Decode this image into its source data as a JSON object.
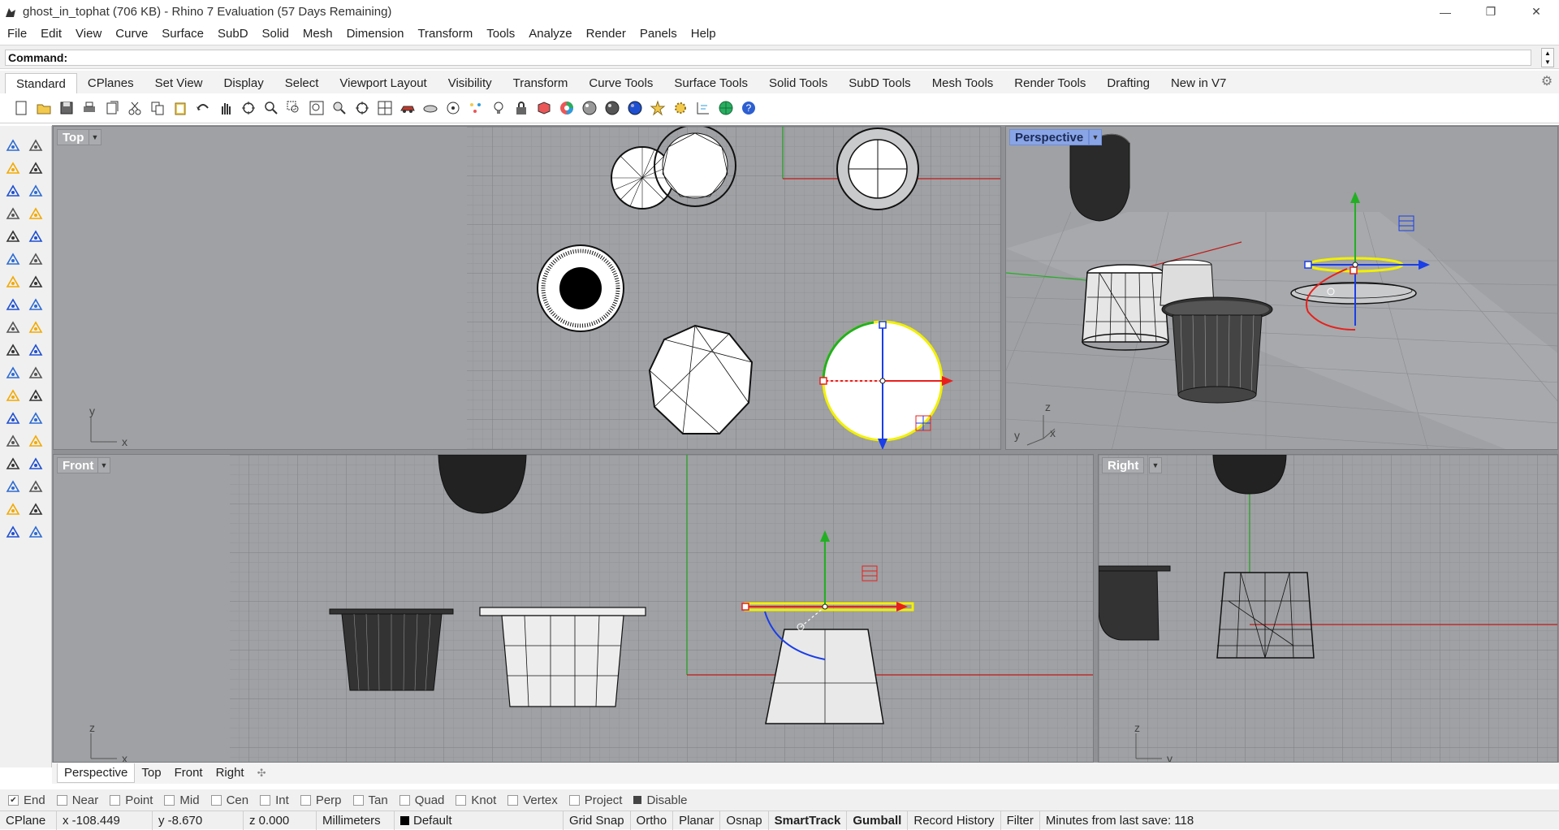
{
  "window": {
    "title": "ghost_in_tophat (706 KB) - Rhino 7 Evaluation (57 Days Remaining)",
    "minimize": "—",
    "restore": "❐",
    "close": "✕"
  },
  "menu": [
    "File",
    "Edit",
    "View",
    "Curve",
    "Surface",
    "SubD",
    "Solid",
    "Mesh",
    "Dimension",
    "Transform",
    "Tools",
    "Analyze",
    "Render",
    "Panels",
    "Help"
  ],
  "command": {
    "label": "Command:",
    "value": ""
  },
  "toolbar_tabs": [
    "Standard",
    "CPlanes",
    "Set View",
    "Display",
    "Select",
    "Viewport Layout",
    "Visibility",
    "Transform",
    "Curve Tools",
    "Surface Tools",
    "Solid Tools",
    "SubD Tools",
    "Mesh Tools",
    "Render Tools",
    "Drafting",
    "New in V7"
  ],
  "toolbar_icons": [
    "new-file-icon",
    "open-file-icon",
    "save-icon",
    "print-icon",
    "import-icon",
    "cut-icon",
    "copy-icon",
    "paste-icon",
    "undo-icon",
    "pan-hand-icon",
    "rotate-view-icon",
    "zoom-icon",
    "zoom-window-icon",
    "zoom-extents-icon",
    "zoom-selected-icon",
    "rotate-view-icon",
    "four-viewports-icon",
    "car-shaded-icon",
    "object-properties-icon",
    "circle-icon",
    "points-icon",
    "light-bulb-icon",
    "lock-icon",
    "cube-render-icon",
    "color-wheel-icon",
    "sphere-material-icon",
    "sphere-render-icon",
    "blue-sphere-icon",
    "stars-icon",
    "gear-group-icon",
    "dimension-icon",
    "globe-icon",
    "help-icon"
  ],
  "viewports": {
    "top": {
      "label": "Top",
      "axis_a": "y",
      "axis_b": "x"
    },
    "perspective": {
      "label": "Perspective",
      "axis_a": "z",
      "axis_b": "y",
      "axis_c": "x"
    },
    "front": {
      "label": "Front",
      "axis_a": "z",
      "axis_b": "x"
    },
    "right": {
      "label": "Right",
      "axis_a": "z",
      "axis_b": "y"
    }
  },
  "viewport_tabs": [
    "Perspective",
    "Top",
    "Front",
    "Right"
  ],
  "add_tab_icon": "✣",
  "osnaps": [
    {
      "label": "End",
      "checked": true
    },
    {
      "label": "Near",
      "checked": false
    },
    {
      "label": "Point",
      "checked": false
    },
    {
      "label": "Mid",
      "checked": false
    },
    {
      "label": "Cen",
      "checked": false
    },
    {
      "label": "Int",
      "checked": false
    },
    {
      "label": "Perp",
      "checked": false
    },
    {
      "label": "Tan",
      "checked": false
    },
    {
      "label": "Quad",
      "checked": false
    },
    {
      "label": "Knot",
      "checked": false
    },
    {
      "label": "Vertex",
      "checked": false
    },
    {
      "label": "Project",
      "checked": false
    }
  ],
  "osnap_disable": "Disable",
  "status": {
    "cplane": "CPlane",
    "x": "x -108.449",
    "y": "y -8.670",
    "z": "z 0.000",
    "units": "Millimeters",
    "layer": "Default",
    "grid_snap": "Grid Snap",
    "ortho": "Ortho",
    "planar": "Planar",
    "osnap": "Osnap",
    "smarttrack": "SmartTrack",
    "gumball": "Gumball",
    "record_history": "Record History",
    "filter": "Filter",
    "minutes": "Minutes from last save: 118"
  },
  "colors": {
    "viewport_bg": "#9fa1a4",
    "grid": "#8e9093",
    "active_label": "#8aa5e6",
    "gumball_red": "#e8201c",
    "gumball_green": "#22b022",
    "gumball_blue": "#1a3ee8",
    "selection": "#f5f500"
  }
}
